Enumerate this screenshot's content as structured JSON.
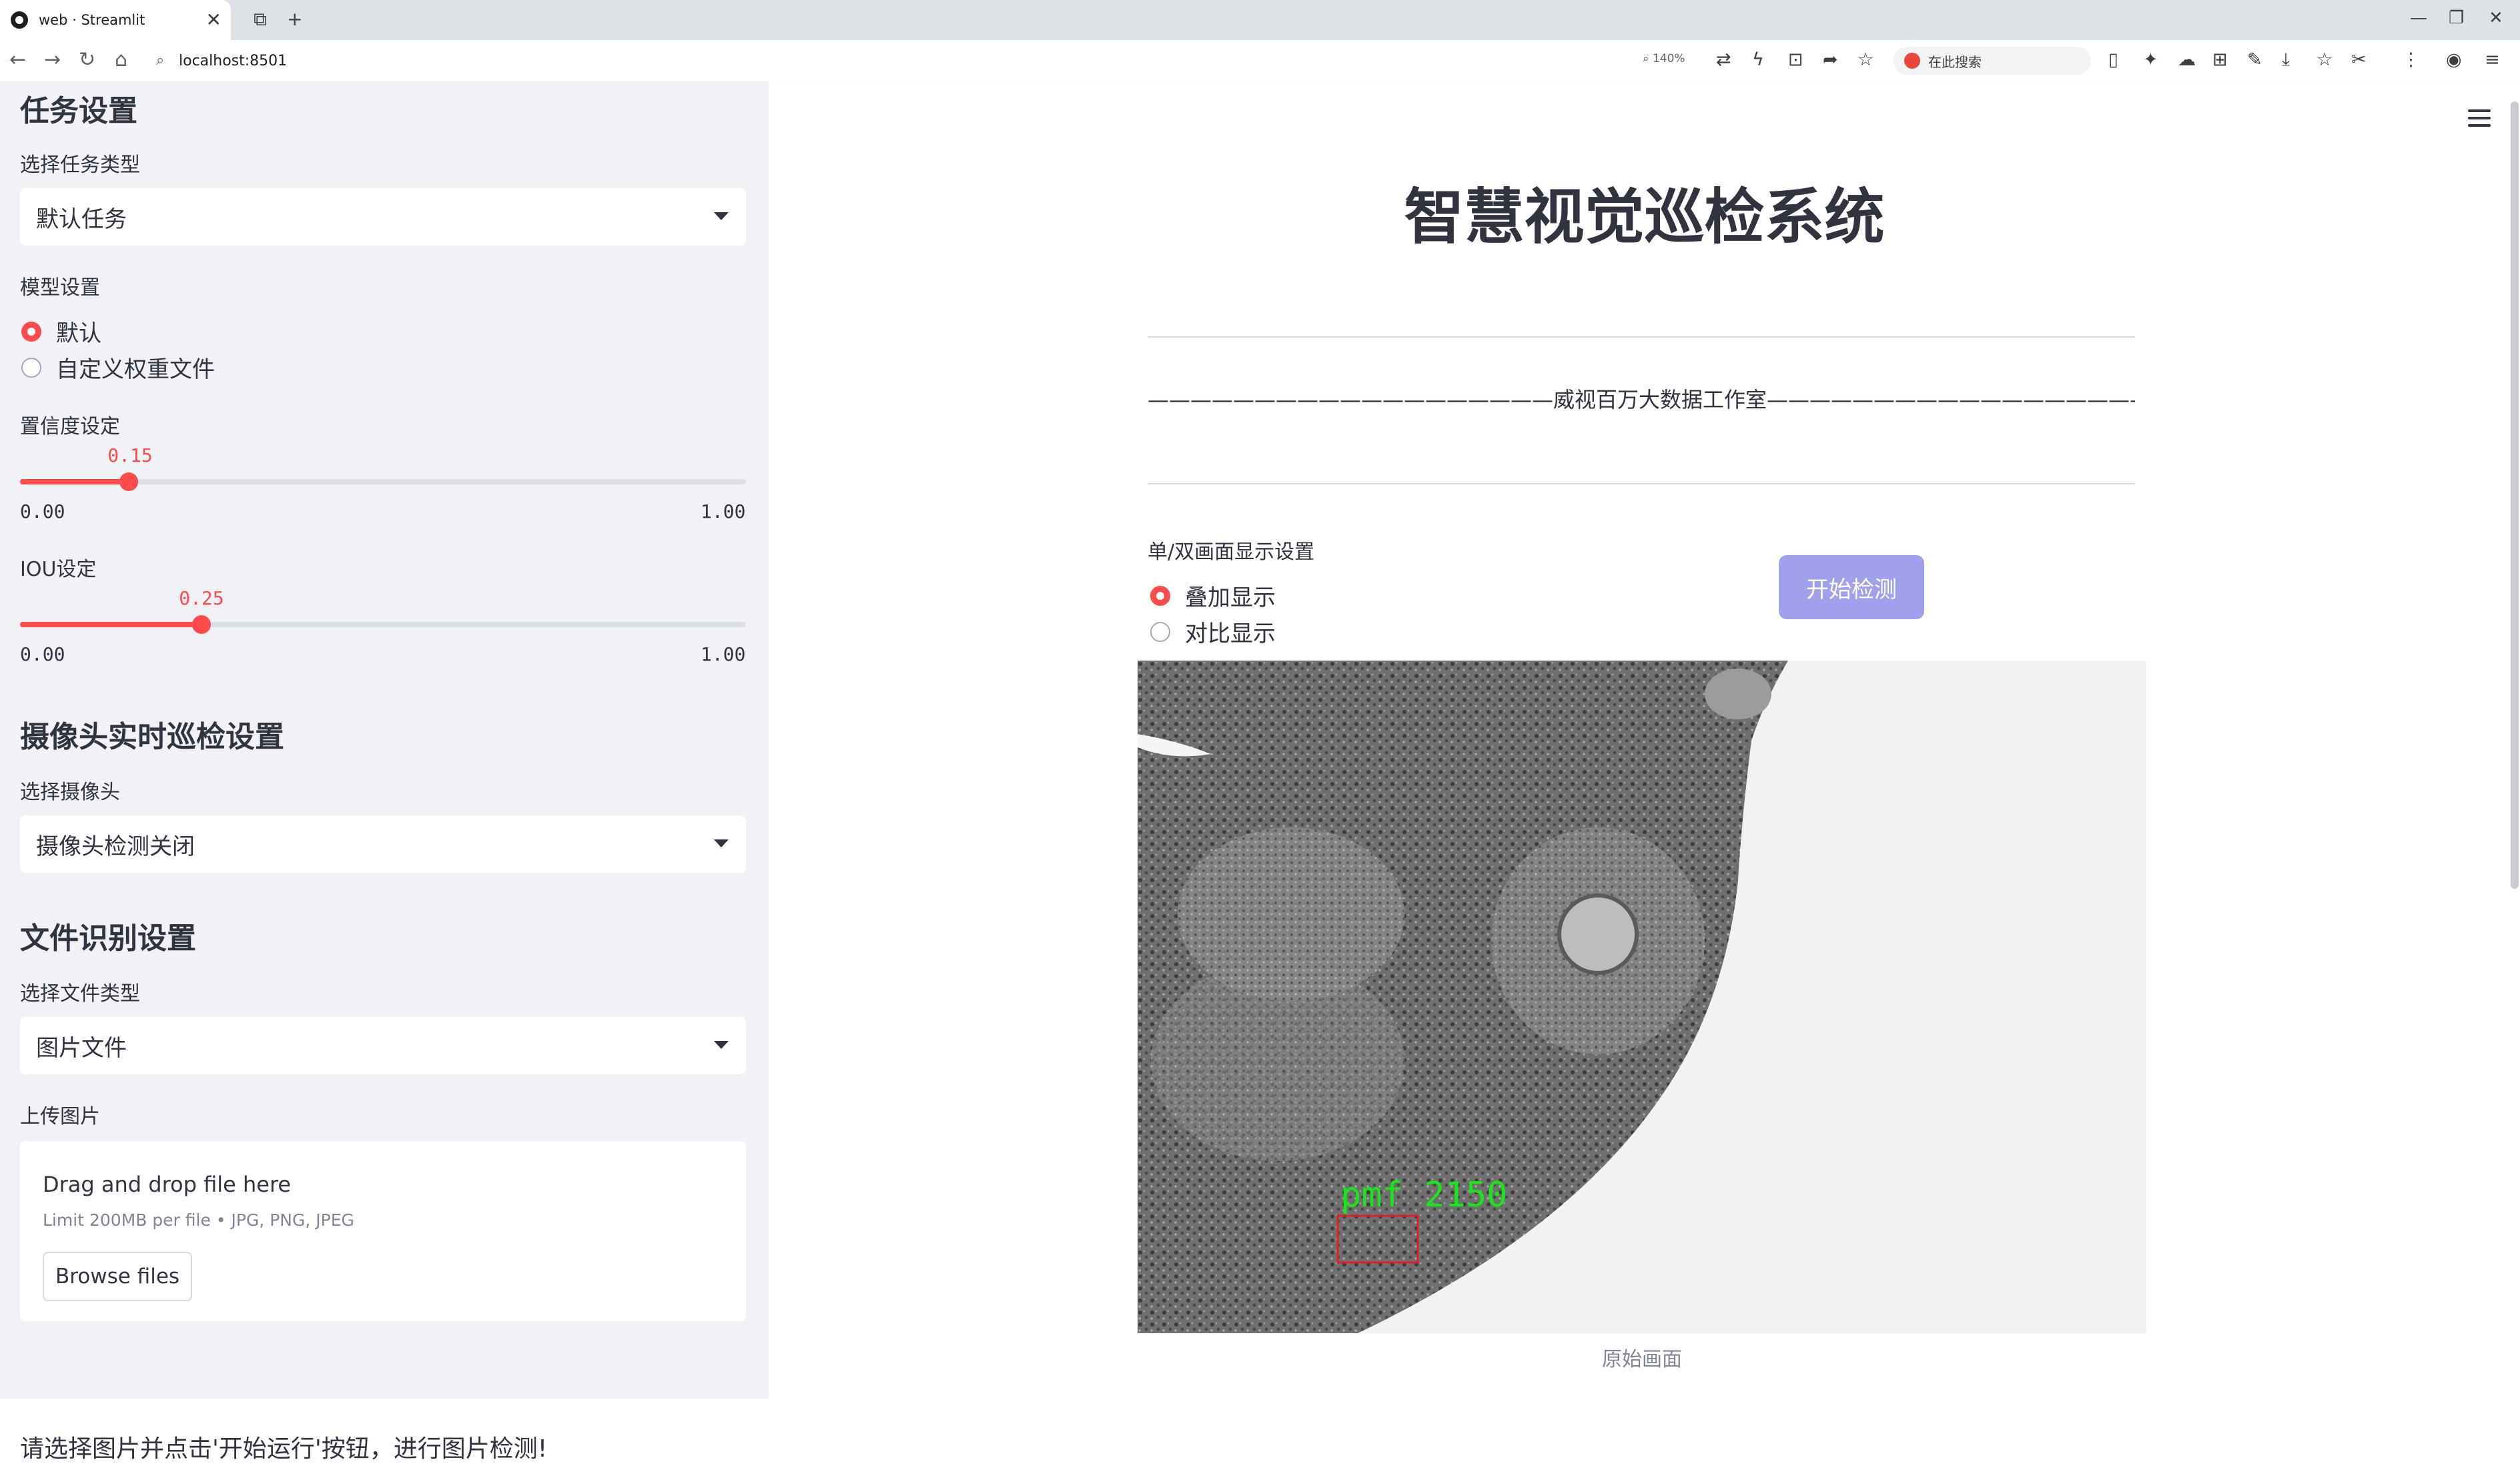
{
  "browser": {
    "tab_title": "web · Streamlit",
    "url": "localhost:8501",
    "zoom": "140%",
    "search_placeholder": "在此搜索"
  },
  "sidebar": {
    "task_section": "任务设置",
    "task_type_label": "选择任务类型",
    "task_type_value": "默认任务",
    "model_label": "模型设置",
    "model_options": [
      "默认",
      "自定义权重文件"
    ],
    "model_selected": "默认",
    "confidence_label": "置信度设定",
    "confidence_value": "0.15",
    "confidence_min": "0.00",
    "confidence_max": "1.00",
    "iou_label": "IOU设定",
    "iou_value": "0.25",
    "iou_min": "0.00",
    "iou_max": "1.00",
    "camera_section": "摄像头实时巡检设置",
    "camera_label": "选择摄像头",
    "camera_value": "摄像头检测关闭",
    "file_section": "文件识别设置",
    "file_type_label": "选择文件类型",
    "file_type_value": "图片文件",
    "upload_label": "上传图片",
    "upload_title": "Drag and drop file here",
    "upload_limit": "Limit 200MB per file • JPG, PNG, JPEG",
    "browse_label": "Browse files",
    "note": "请选择图片并点击'开始运行'按钮，进行图片检测!"
  },
  "main": {
    "title": "智慧视觉巡检系统",
    "subtitle": "———————————————————威视百万大数据工作室————————————————————",
    "display_label": "单/双画面显示设置",
    "display_options": [
      "叠加显示",
      "对比显示"
    ],
    "display_selected": "叠加显示",
    "start_button": "开始检测",
    "detection_label": "pmf 2150",
    "caption": "原始画面"
  },
  "colors": {
    "accent": "#ff4b4b",
    "button": "#a1a0ec",
    "sidebar_bg": "#f0f2f6",
    "detection_box": "#e02020",
    "detection_text": "#19e619"
  }
}
